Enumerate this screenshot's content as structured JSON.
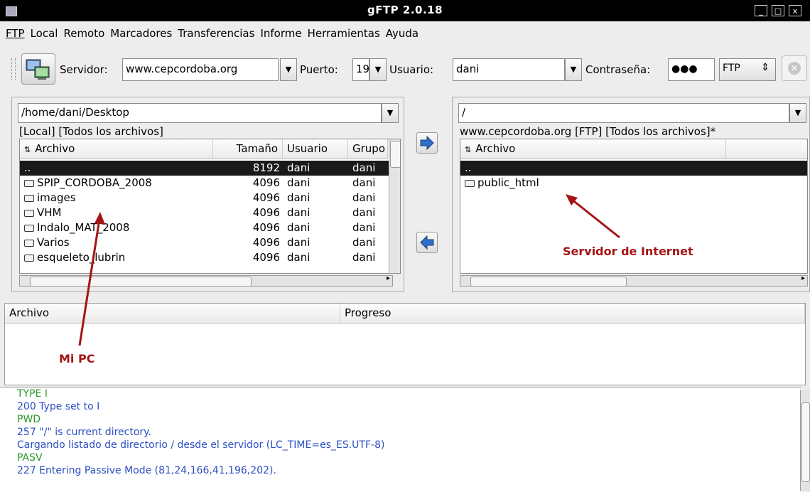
{
  "window": {
    "title": "gFTP 2.0.18",
    "controls": [
      "_",
      "□",
      "x"
    ]
  },
  "menu": [
    "FTP",
    "Local",
    "Remoto",
    "Marcadores",
    "Transferencias",
    "Informe",
    "Herramientas",
    "Ayuda"
  ],
  "toolbar": {
    "server_label": "Servidor:",
    "server_value": "www.cepcordoba.org",
    "port_label": "Puerto:",
    "port_value": "19",
    "user_label": "Usuario:",
    "user_value": "dani",
    "password_label": "Contraseña:",
    "password_value": "●●●",
    "protocol": "FTP"
  },
  "local": {
    "path": "/home/dani/Desktop",
    "status": "[Local] [Todos los archivos]",
    "columns": [
      "Archivo",
      "Tamaño",
      "Usuario",
      "Grupo"
    ],
    "rows": [
      {
        "name": "..",
        "size": "8192",
        "user": "dani",
        "group": "dani"
      },
      {
        "name": "SPIP_CORDOBA_2008",
        "size": "4096",
        "user": "dani",
        "group": "dani"
      },
      {
        "name": "images",
        "size": "4096",
        "user": "dani",
        "group": "dani"
      },
      {
        "name": "VHM",
        "size": "4096",
        "user": "dani",
        "group": "dani"
      },
      {
        "name": "Indalo_MAT_2008",
        "size": "4096",
        "user": "dani",
        "group": "dani"
      },
      {
        "name": "Varios",
        "size": "4096",
        "user": "dani",
        "group": "dani"
      },
      {
        "name": "esqueleto_lubrin",
        "size": "4096",
        "user": "dani",
        "group": "dani"
      }
    ]
  },
  "remote": {
    "path": "/",
    "status": "www.cepcordoba.org [FTP] [Todos los archivos]*",
    "column": "Archivo",
    "rows": [
      {
        "name": ".."
      },
      {
        "name": "public_html"
      }
    ]
  },
  "transfers": {
    "col_file": "Archivo",
    "col_progress": "Progreso"
  },
  "annotations": {
    "local": "Mi PC",
    "remote": "Servidor de Internet"
  },
  "log": [
    {
      "text": "TYPE I",
      "color": "green"
    },
    {
      "text": "200 Type set to I",
      "color": "blue"
    },
    {
      "text": "PWD",
      "color": "green"
    },
    {
      "text": "257 \"/\" is current directory.",
      "color": "blue"
    },
    {
      "text": "Cargando listado de directorio / desde el servidor (LC_TIME=es_ES.UTF-8)",
      "color": "blue"
    },
    {
      "text": "PASV",
      "color": "green"
    },
    {
      "text": "227 Entering Passive Mode (81,24,166,41,196,202).",
      "color": "blue"
    }
  ]
}
